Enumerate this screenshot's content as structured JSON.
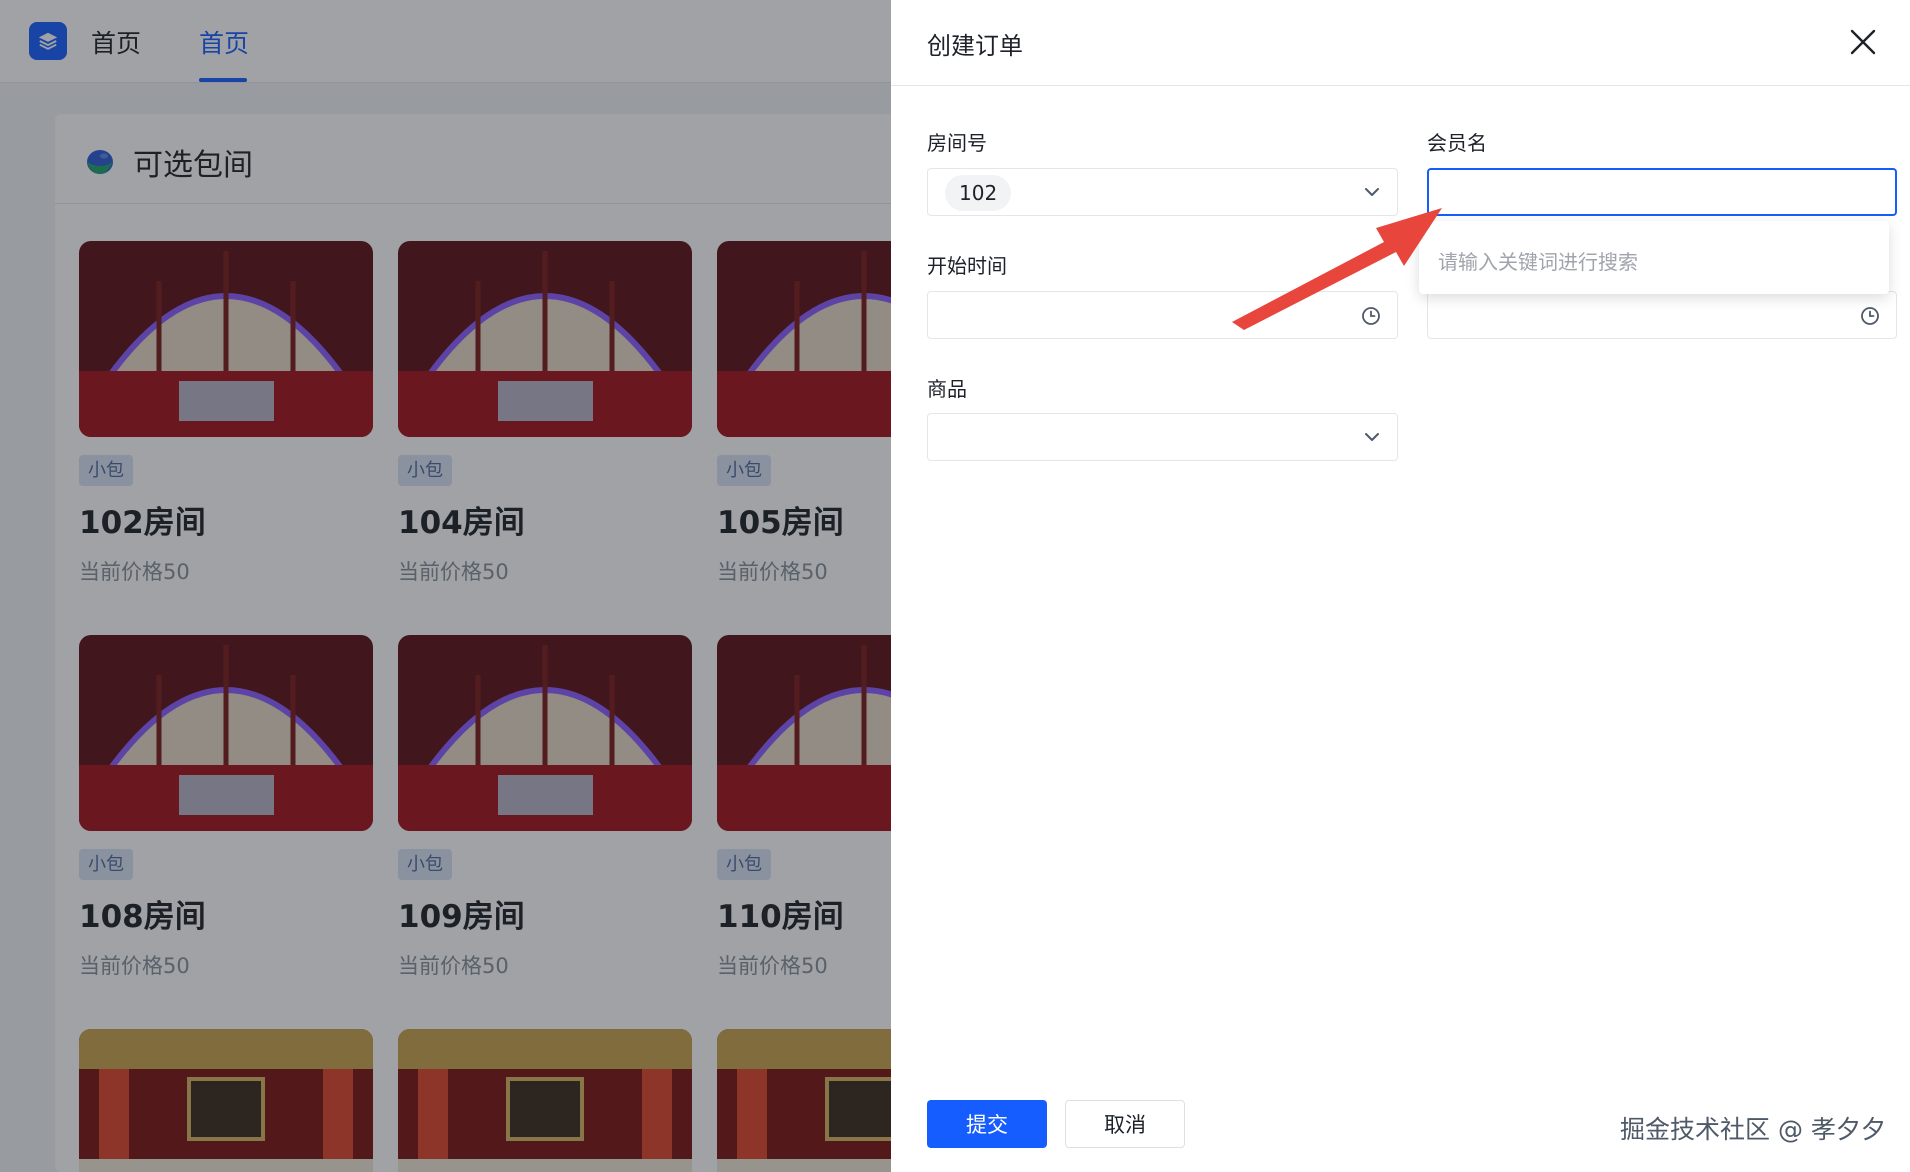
{
  "header": {
    "nav": [
      {
        "label": "首页"
      },
      {
        "label": "首页"
      }
    ]
  },
  "panel": {
    "title": "可选包间"
  },
  "rooms": [
    {
      "tag": "小包",
      "name": "102房间",
      "price": "当前价格50"
    },
    {
      "tag": "小包",
      "name": "104房间",
      "price": "当前价格50"
    },
    {
      "tag": "小包",
      "name": "105房间",
      "price": "当前价格50"
    },
    {
      "tag": "小包",
      "name": "108房间",
      "price": "当前价格50"
    },
    {
      "tag": "小包",
      "name": "109房间",
      "price": "当前价格50"
    },
    {
      "tag": "小包",
      "name": "110房间",
      "price": "当前价格50"
    }
  ],
  "drawer": {
    "title": "创建订单",
    "fields": {
      "room_number": {
        "label": "房间号",
        "value": "102"
      },
      "member_name": {
        "label": "会员名",
        "dropdown_placeholder": "请输入关键词进行搜索"
      },
      "start_time": {
        "label": "开始时间"
      },
      "goods": {
        "label": "商品"
      }
    },
    "submit_label": "提交",
    "cancel_label": "取消"
  },
  "watermark": "掘金技术社区 @ 孝夕夕",
  "colors": {
    "primary": "#165dff",
    "tag_bg": "#dbe3f5",
    "annotation_arrow": "#e8453c"
  }
}
